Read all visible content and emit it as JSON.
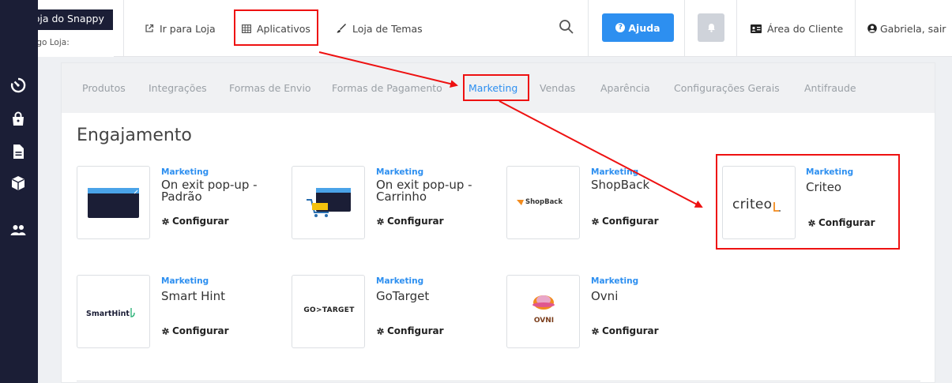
{
  "brand": {
    "name": "Loja do Snappy",
    "store_code_label": "Código Loja:"
  },
  "topnav": {
    "store_link": "Ir para Loja",
    "apps_link": "Aplicativos",
    "themes_link": "Loja de Temas",
    "help_button": "Ajuda",
    "client_area": "Área do Cliente",
    "user": "Gabriela, sair"
  },
  "tabs": [
    {
      "label": "Produtos"
    },
    {
      "label": "Integrações"
    },
    {
      "label": "Formas de Envio"
    },
    {
      "label": "Formas de Pagamento"
    },
    {
      "label": "Marketing"
    },
    {
      "label": "Vendas"
    },
    {
      "label": "Aparência"
    },
    {
      "label": "Configurações Gerais"
    },
    {
      "label": "Antifraude"
    }
  ],
  "active_tab": "Marketing",
  "section": {
    "title": "Engajamento"
  },
  "apps": [
    {
      "category": "Marketing",
      "name": "On exit pop-up - Padrão",
      "action": "Configurar"
    },
    {
      "category": "Marketing",
      "name": "On exit pop-up - Carrinho",
      "action": "Configurar"
    },
    {
      "category": "Marketing",
      "name": "ShopBack",
      "action": "Configurar",
      "logo_text": "ShopBack"
    },
    {
      "category": "Marketing",
      "name": "Criteo",
      "action": "Configurar",
      "logo_text": "criteo"
    },
    {
      "category": "Marketing",
      "name": "Smart Hint",
      "action": "Configurar",
      "logo_text": "SmartHint"
    },
    {
      "category": "Marketing",
      "name": "GoTarget",
      "action": "Configurar",
      "logo_text": "GO>TARGET"
    },
    {
      "category": "Marketing",
      "name": "Ovni",
      "action": "Configurar",
      "logo_text": "OVNI"
    }
  ],
  "colors": {
    "accent": "#2d8ff0",
    "sidebar": "#1b1e36",
    "highlight": "#ee1111"
  }
}
